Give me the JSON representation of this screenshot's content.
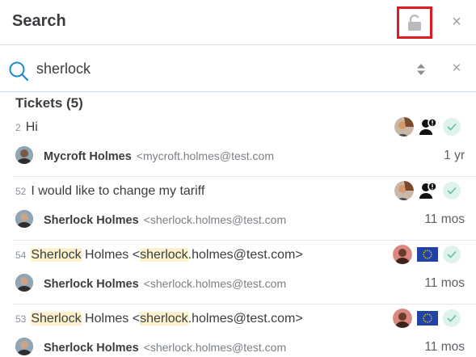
{
  "header": {
    "title": "Search"
  },
  "search": {
    "query": "sherlock"
  },
  "results": {
    "section_title": "Tickets (5)"
  },
  "tickets": [
    {
      "number": "2",
      "title_parts": [
        {
          "text": "Hi",
          "hl": false
        }
      ],
      "customer_name": "Mycroft Holmes",
      "customer_email": "<mycroft.holmes@test.com",
      "age": "1 yr",
      "badge": "agent-status"
    },
    {
      "number": "52",
      "title_parts": [
        {
          "text": "I would like to change my tariff",
          "hl": false
        }
      ],
      "customer_name": "Sherlock Holmes",
      "customer_email": "<sherlock.holmes@test.com",
      "age": "11 mos",
      "badge": "agent-status"
    },
    {
      "number": "54",
      "title_parts": [
        {
          "text": "Sherlock",
          "hl": true
        },
        {
          "text": " Holmes <",
          "hl": false
        },
        {
          "text": "sherlock",
          "hl": true
        },
        {
          "text": ".holmes@test.com>",
          "hl": false
        }
      ],
      "customer_name": "Sherlock Holmes",
      "customer_email": "<sherlock.holmes@test.com",
      "age": "11 mos",
      "badge": "eu-flag"
    },
    {
      "number": "53",
      "title_parts": [
        {
          "text": "Sherlock",
          "hl": true
        },
        {
          "text": " Holmes <",
          "hl": false
        },
        {
          "text": "sherlock",
          "hl": true
        },
        {
          "text": ".holmes@test.com>",
          "hl": false
        }
      ],
      "customer_name": "Sherlock Holmes",
      "customer_email": "<sherlock.holmes@test.com",
      "age": "11 mos",
      "badge": "eu-flag"
    }
  ],
  "icons": {
    "header_close": "×",
    "search_clear": "×"
  },
  "colors": {
    "accent": "#1a8ad4",
    "highlight": "#fdf1cc",
    "lock_border": "#e01820",
    "check": "#5fbfa0"
  }
}
